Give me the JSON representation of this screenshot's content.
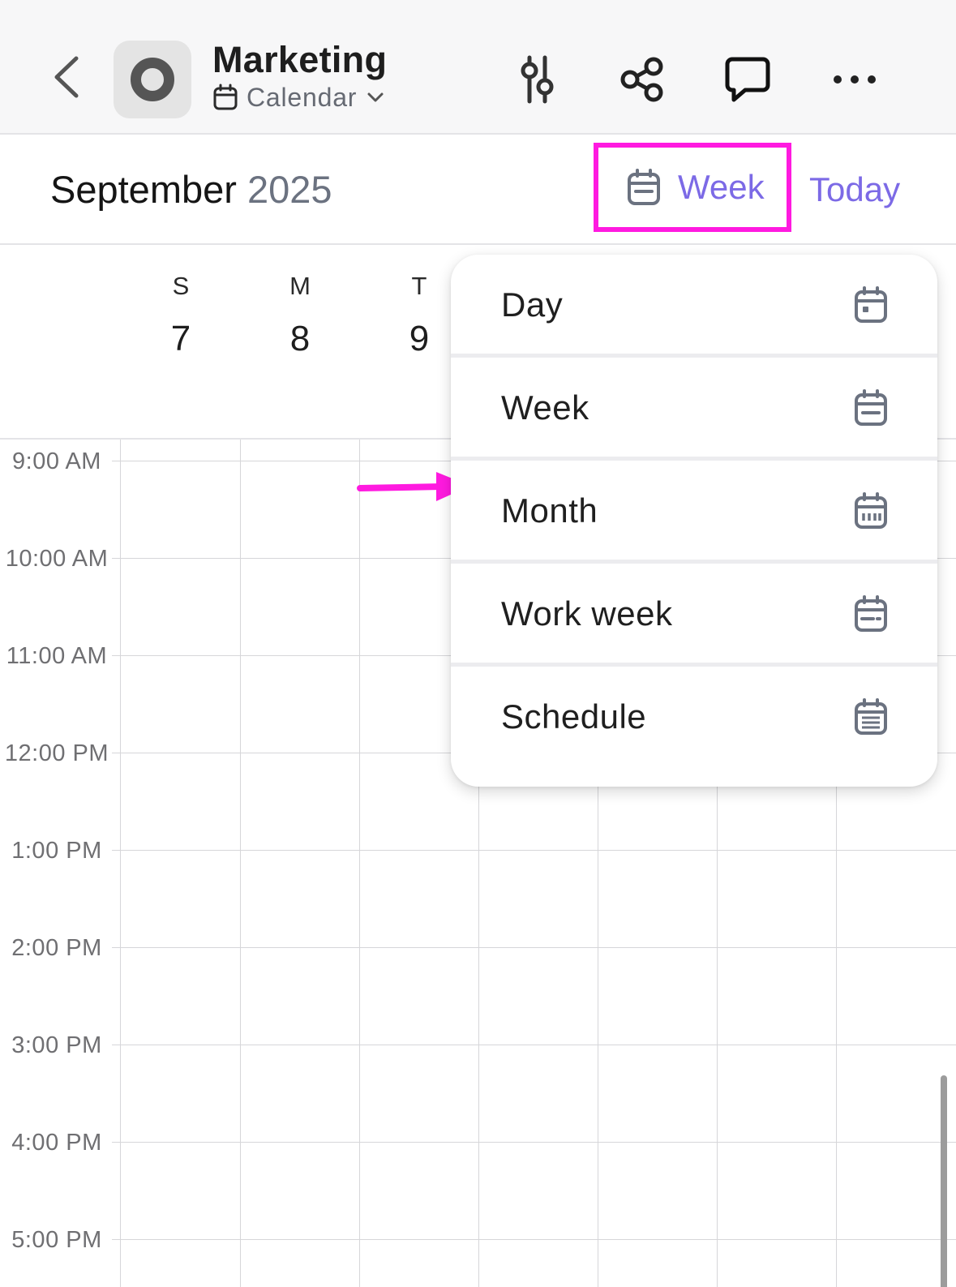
{
  "header": {
    "title": "Marketing",
    "subtitle": "Calendar",
    "icons": [
      "back-chevron-icon",
      "app-ring-icon",
      "calendar-icon",
      "chevron-down-icon",
      "sliders-icon",
      "share-icon",
      "comment-icon",
      "more-icon"
    ]
  },
  "calendar": {
    "month": "September",
    "year": "2025",
    "view_label": "Week",
    "today_label": "Today",
    "days": [
      {
        "letter": "S",
        "number": "7"
      },
      {
        "letter": "M",
        "number": "8"
      },
      {
        "letter": "T",
        "number": "9"
      }
    ],
    "hours": [
      "9:00 AM",
      "10:00 AM",
      "11:00 AM",
      "12:00 PM",
      "1:00 PM",
      "2:00 PM",
      "3:00 PM",
      "4:00 PM",
      "5:00 PM"
    ]
  },
  "view_menu": {
    "items": [
      {
        "label": "Day",
        "icon": "calendar-day-icon"
      },
      {
        "label": "Week",
        "icon": "calendar-week-icon"
      },
      {
        "label": "Month",
        "icon": "calendar-month-icon"
      },
      {
        "label": "Work week",
        "icon": "calendar-workweek-icon"
      },
      {
        "label": "Schedule",
        "icon": "calendar-schedule-icon"
      }
    ]
  },
  "colors": {
    "accent": "#7c6ae6",
    "highlight": "#ff1ae0",
    "grid": "#d6d6d9",
    "muted_text": "#6f6f72"
  }
}
